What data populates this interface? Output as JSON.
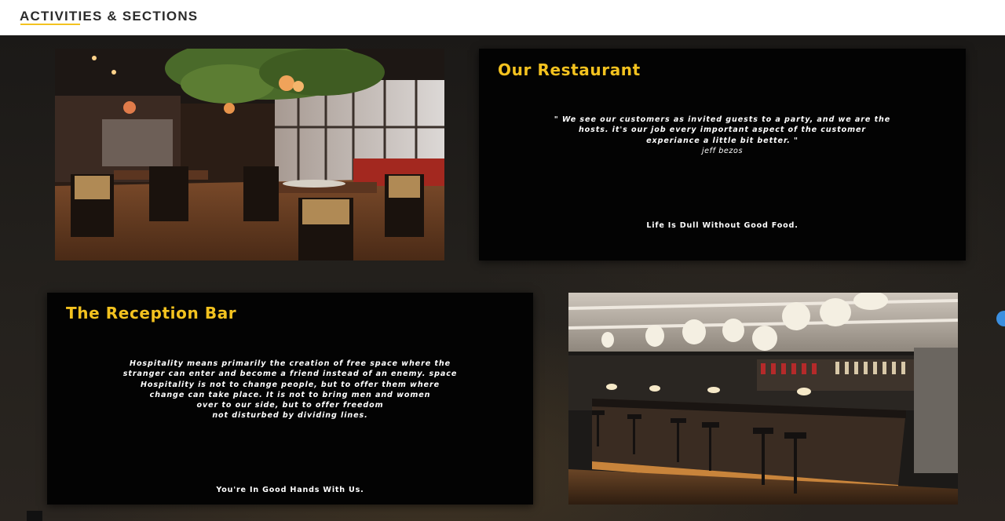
{
  "header": {
    "title": "ACTIVITIES & SECTIONS"
  },
  "sections": {
    "restaurant": {
      "title": "Our Restaurant",
      "quote_lines": [
        "\" We see our customers as invited guests to a party, and we are the",
        "hosts. it's our job every important aspect of the customer",
        "experiance a little bit better. \""
      ],
      "quote_author": "jeff bezos",
      "tagline": "Life Is Dull Without Good Food.",
      "image": "restaurant-dining-room-photo"
    },
    "reception_bar": {
      "title": "The Reception Bar",
      "quote_lines": [
        "Hospitality means primarily the creation of free space where the",
        "stranger can enter and become a friend instead of an enemy. space",
        "Hospitality is not to change people, but to offer them where",
        "change can take place. It is not to bring men and women",
        "over to our side, but to offer freedom",
        "not disturbed by dividing lines."
      ],
      "tagline": "You're In Good Hands With Us.",
      "image": "reception-bar-photo"
    }
  },
  "colors": {
    "accent": "#f3c21f",
    "card_background": "#030303",
    "page_background": "#1d1b19",
    "header_background": "#ffffff"
  }
}
